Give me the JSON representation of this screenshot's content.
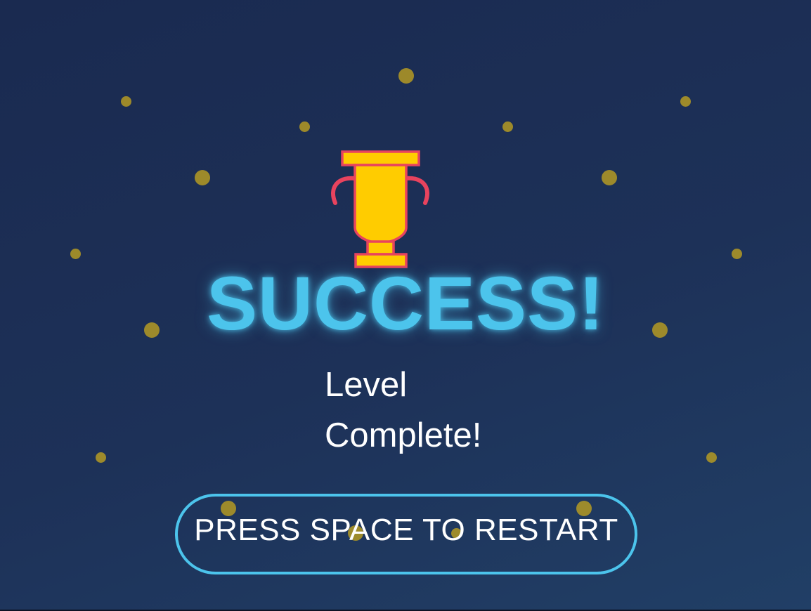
{
  "screen": {
    "title": "SUCCESS!",
    "subtitle": "Level Complete!",
    "restart_label": "PRESS SPACE TO RESTART"
  },
  "icons": {
    "trophy": "trophy-icon",
    "particles": "sparkle-dot"
  },
  "colors": {
    "title": "#4cc4ec",
    "button_border": "#4cc4ec",
    "trophy_fill": "#ffcc00",
    "trophy_outline": "#e8435e",
    "particle": "#b49a23",
    "background": "#1d3158"
  }
}
